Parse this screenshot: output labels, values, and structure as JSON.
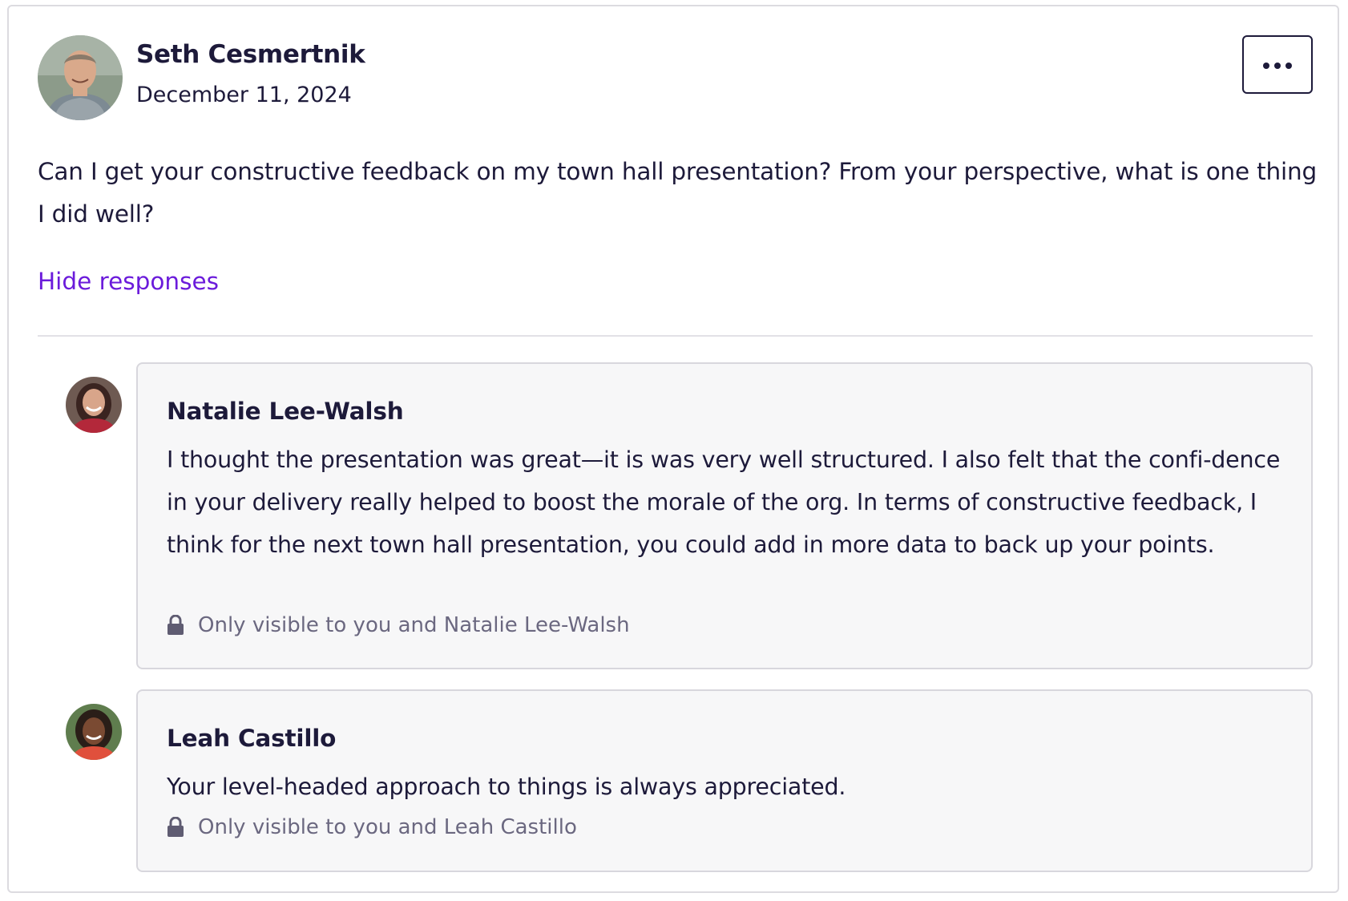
{
  "post": {
    "author": "Seth Cesmertnik",
    "date": "December 11, 2024",
    "question": "Can I get your constructive feedback on my town hall presentation? From your perspective, what is one thing I did well?",
    "hide_responses_label": "Hide responses",
    "more_options_icon": "ellipsis-icon"
  },
  "responses": [
    {
      "name": "Natalie Lee-Walsh",
      "text": "I thought the presentation was great—it is was very well structured. I also felt that the confi-dence in your delivery really helped to boost the morale of the org. In terms of constructive feedback, I think for the next town hall presentation, you could add in more data to back up your points.",
      "visibility": "Only visible to you and Natalie Lee-Walsh",
      "visibility_icon": "lock-icon"
    },
    {
      "name": "Leah Castillo",
      "text": "Your level-headed approach to things is always appreciated.",
      "visibility": "Only visible to you and Leah Castillo",
      "visibility_icon": "lock-icon"
    }
  ],
  "colors": {
    "text": "#1d1a3a",
    "link": "#6b1bdb",
    "muted": "#6b6880",
    "response_bg": "#f7f7f8",
    "border": "#d8d7dd"
  }
}
